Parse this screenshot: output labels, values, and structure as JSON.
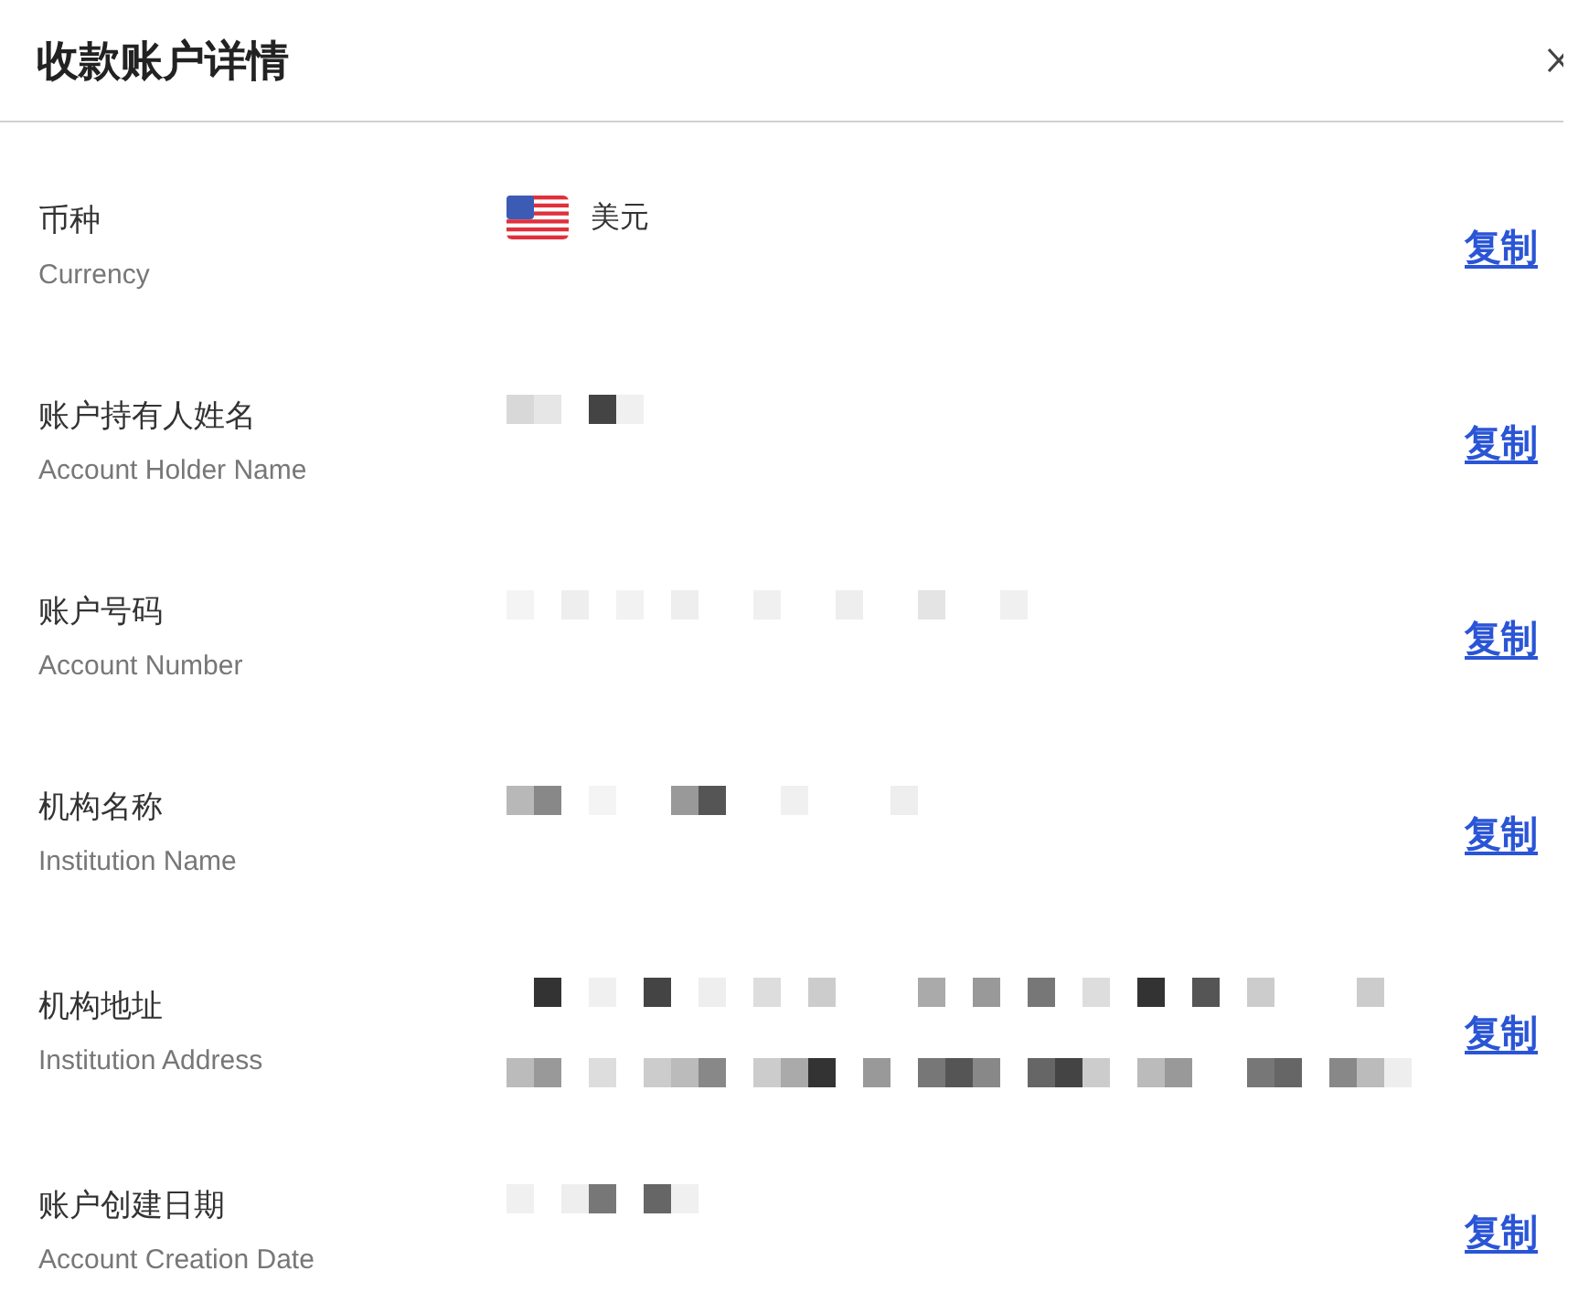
{
  "dialog": {
    "title": "收款账户详情"
  },
  "fields": [
    {
      "label": "币种",
      "label_en": "Currency",
      "kind": "currency",
      "value": "美元",
      "action": "复制"
    },
    {
      "label": "账户持有人姓名",
      "label_en": "Account Holder Name",
      "kind": "redacted",
      "action": "复制"
    },
    {
      "label": "账户号码",
      "label_en": "Account Number",
      "kind": "redacted",
      "action": "复制"
    },
    {
      "label": "机构名称",
      "label_en": "Institution Name",
      "kind": "redacted",
      "action": "复制"
    },
    {
      "label": "机构地址",
      "label_en": "Institution Address",
      "kind": "redacted-multiline",
      "action": "复制"
    },
    {
      "label": "账户创建日期",
      "label_en": "Account Creation Date",
      "kind": "redacted",
      "action": "复制"
    }
  ]
}
